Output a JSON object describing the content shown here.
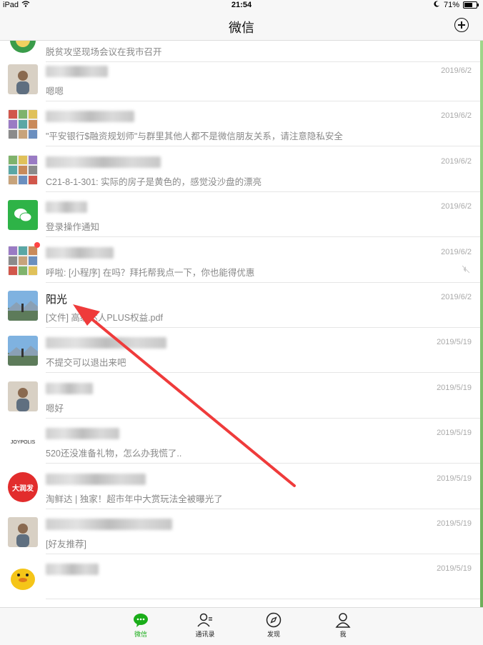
{
  "status": {
    "carrier": "iPad",
    "time": "21:54",
    "battery": "71%",
    "battery_level": 0.71
  },
  "nav": {
    "title": "微信"
  },
  "chats": [
    {
      "name": "",
      "preview": "脱贫攻坚现场会议在我市召开",
      "time": "",
      "avatar": "green-emblem-avatar",
      "partial": true
    },
    {
      "name": "",
      "preview": "嗯嗯",
      "time": "2019/6/2",
      "avatar": "person-avatar"
    },
    {
      "name": "",
      "preview": "\"平安银行$融资规划师\"与群里其他人都不是微信朋友关系，请注意隐私安全",
      "time": "2019/6/2",
      "avatar": "group-avatar"
    },
    {
      "name": "",
      "preview": "C21-8-1-301: 实际的房子是黄色的，感觉没沙盘的漂亮",
      "time": "2019/6/2",
      "avatar": "group-avatar"
    },
    {
      "name": "",
      "preview": "登录操作通知",
      "time": "2019/6/2",
      "avatar": "wechat-avatar"
    },
    {
      "name": "",
      "preview": "呼啦: [小程序] 在吗？拜托帮我点一下，你也能得优惠",
      "time": "2019/6/2",
      "avatar": "group-avatar",
      "dot": true,
      "muted": true
    },
    {
      "name": "阳光",
      "preview": "[文件] 高级达人PLUS权益.pdf",
      "time": "2019/6/2",
      "avatar": "landscape-avatar"
    },
    {
      "name": "",
      "preview": "不提交可以退出来吧",
      "time": "2019/5/19",
      "avatar": "landscape-avatar"
    },
    {
      "name": "",
      "preview": "嗯好",
      "time": "2019/5/19",
      "avatar": "person-avatar"
    },
    {
      "name": "",
      "preview": "520还没准备礼物，怎么办我慌了..",
      "time": "2019/5/19",
      "avatar": "joypolis-avatar"
    },
    {
      "name": "",
      "preview": "淘鲜达 | 独家！超市年中大赏玩法全被曝光了",
      "time": "2019/5/19",
      "avatar": "red-logo-avatar",
      "logo_text": "大润发"
    },
    {
      "name": "",
      "preview": "[好友推荐]",
      "time": "2019/5/19",
      "avatar": "person-avatar"
    },
    {
      "name": "",
      "preview": "",
      "time": "2019/5/19",
      "avatar": "duck-avatar",
      "partial": true
    }
  ],
  "tabs": [
    {
      "label": "微信",
      "icon": "chat-bubble-icon",
      "active": true
    },
    {
      "label": "通讯录",
      "icon": "contacts-icon",
      "active": false
    },
    {
      "label": "发现",
      "icon": "compass-icon",
      "active": false
    },
    {
      "label": "我",
      "icon": "profile-icon",
      "active": false
    }
  ],
  "colors": {
    "accent": "#1aad19",
    "arrow": "#ef3b3b"
  }
}
